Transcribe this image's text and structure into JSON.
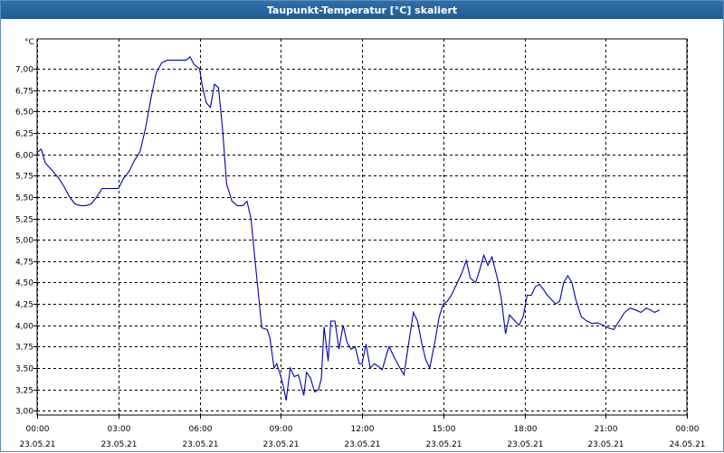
{
  "window": {
    "title": "Taupunkt-Temperatur [°C] skaliert"
  },
  "colors": {
    "titlebar": "#2a679e",
    "line": "#0000b0",
    "grid": "#000000"
  },
  "chart_data": {
    "type": "line",
    "title": "Taupunkt-Temperatur [°C] skaliert",
    "ylabel": "°C",
    "xlabel": "",
    "ylim": [
      3.0,
      7.25
    ],
    "xlim": [
      "23.05.21 00:00",
      "24.05.21 00:00"
    ],
    "grid": true,
    "y_ticks": [
      "3,00",
      "3,25",
      "3,50",
      "3,75",
      "4,00",
      "4,25",
      "4,50",
      "4,75",
      "5,00",
      "5,25",
      "5,50",
      "5,75",
      "6,00",
      "6,25",
      "6,50",
      "6,75",
      "7,00"
    ],
    "x_ticks": [
      {
        "time": "00:00",
        "date": "23.05.21"
      },
      {
        "time": "03:00",
        "date": "23.05.21"
      },
      {
        "time": "06:00",
        "date": "23.05.21"
      },
      {
        "time": "09:00",
        "date": "23.05.21"
      },
      {
        "time": "12:00",
        "date": "23.05.21"
      },
      {
        "time": "15:00",
        "date": "23.05.21"
      },
      {
        "time": "18:00",
        "date": "23.05.21"
      },
      {
        "time": "21:00",
        "date": "23.05.21"
      },
      {
        "time": "00:00",
        "date": "24.05.21"
      }
    ],
    "x_unit": "hours since 23.05.21 00:00",
    "series": [
      {
        "points": [
          [
            0.0,
            6.02
          ],
          [
            0.15,
            6.06
          ],
          [
            0.3,
            5.9
          ],
          [
            0.5,
            5.83
          ],
          [
            0.8,
            5.72
          ],
          [
            1.0,
            5.62
          ],
          [
            1.2,
            5.5
          ],
          [
            1.4,
            5.42
          ],
          [
            1.6,
            5.4
          ],
          [
            1.8,
            5.4
          ],
          [
            2.0,
            5.42
          ],
          [
            2.2,
            5.5
          ],
          [
            2.4,
            5.6
          ],
          [
            2.7,
            5.6
          ],
          [
            3.0,
            5.6
          ],
          [
            3.2,
            5.72
          ],
          [
            3.4,
            5.8
          ],
          [
            3.6,
            5.93
          ],
          [
            3.8,
            6.03
          ],
          [
            4.0,
            6.3
          ],
          [
            4.2,
            6.65
          ],
          [
            4.4,
            6.95
          ],
          [
            4.6,
            7.07
          ],
          [
            4.8,
            7.1
          ],
          [
            5.0,
            7.1
          ],
          [
            5.2,
            7.1
          ],
          [
            5.4,
            7.1
          ],
          [
            5.5,
            7.1
          ],
          [
            5.65,
            7.14
          ],
          [
            5.8,
            7.05
          ],
          [
            6.0,
            7.0
          ],
          [
            6.1,
            6.8
          ],
          [
            6.25,
            6.6
          ],
          [
            6.4,
            6.55
          ],
          [
            6.55,
            6.82
          ],
          [
            6.7,
            6.78
          ],
          [
            6.85,
            6.3
          ],
          [
            7.0,
            5.65
          ],
          [
            7.2,
            5.45
          ],
          [
            7.4,
            5.4
          ],
          [
            7.6,
            5.4
          ],
          [
            7.75,
            5.45
          ],
          [
            7.9,
            5.25
          ],
          [
            8.1,
            4.6
          ],
          [
            8.3,
            3.97
          ],
          [
            8.5,
            3.95
          ],
          [
            8.6,
            3.85
          ],
          [
            8.75,
            3.5
          ],
          [
            8.85,
            3.55
          ],
          [
            9.0,
            3.4
          ],
          [
            9.1,
            3.28
          ],
          [
            9.2,
            3.12
          ],
          [
            9.35,
            3.5
          ],
          [
            9.5,
            3.4
          ],
          [
            9.65,
            3.42
          ],
          [
            9.75,
            3.3
          ],
          [
            9.85,
            3.18
          ],
          [
            9.95,
            3.45
          ],
          [
            10.1,
            3.38
          ],
          [
            10.25,
            3.22
          ],
          [
            10.4,
            3.25
          ],
          [
            10.5,
            3.38
          ],
          [
            10.6,
            3.98
          ],
          [
            10.75,
            3.58
          ],
          [
            10.85,
            4.05
          ],
          [
            11.0,
            4.05
          ],
          [
            11.15,
            3.72
          ],
          [
            11.3,
            4.0
          ],
          [
            11.45,
            3.8
          ],
          [
            11.6,
            3.72
          ],
          [
            11.75,
            3.75
          ],
          [
            11.9,
            3.55
          ],
          [
            12.0,
            3.55
          ],
          [
            12.15,
            3.78
          ],
          [
            12.3,
            3.5
          ],
          [
            12.45,
            3.55
          ],
          [
            12.6,
            3.52
          ],
          [
            12.75,
            3.48
          ],
          [
            12.9,
            3.65
          ],
          [
            13.0,
            3.75
          ],
          [
            13.2,
            3.62
          ],
          [
            13.4,
            3.5
          ],
          [
            13.55,
            3.42
          ],
          [
            13.75,
            3.85
          ],
          [
            13.9,
            4.15
          ],
          [
            14.05,
            4.05
          ],
          [
            14.2,
            3.8
          ],
          [
            14.35,
            3.6
          ],
          [
            14.5,
            3.5
          ],
          [
            14.7,
            3.82
          ],
          [
            14.85,
            4.1
          ],
          [
            15.0,
            4.25
          ],
          [
            15.15,
            4.28
          ],
          [
            15.3,
            4.35
          ],
          [
            15.45,
            4.45
          ],
          [
            15.55,
            4.52
          ],
          [
            15.7,
            4.62
          ],
          [
            15.85,
            4.76
          ],
          [
            16.0,
            4.55
          ],
          [
            16.2,
            4.5
          ],
          [
            16.35,
            4.65
          ],
          [
            16.5,
            4.82
          ],
          [
            16.65,
            4.7
          ],
          [
            16.8,
            4.8
          ],
          [
            17.0,
            4.55
          ],
          [
            17.15,
            4.3
          ],
          [
            17.3,
            3.9
          ],
          [
            17.45,
            4.12
          ],
          [
            17.65,
            4.05
          ],
          [
            17.8,
            4.0
          ],
          [
            17.95,
            4.1
          ],
          [
            18.1,
            4.35
          ],
          [
            18.25,
            4.35
          ],
          [
            18.4,
            4.45
          ],
          [
            18.55,
            4.48
          ],
          [
            18.7,
            4.42
          ],
          [
            18.85,
            4.35
          ],
          [
            19.0,
            4.3
          ],
          [
            19.15,
            4.25
          ],
          [
            19.3,
            4.28
          ],
          [
            19.45,
            4.5
          ],
          [
            19.6,
            4.58
          ],
          [
            19.75,
            4.5
          ],
          [
            19.9,
            4.3
          ],
          [
            20.1,
            4.1
          ],
          [
            20.3,
            4.05
          ],
          [
            20.5,
            4.02
          ],
          [
            20.7,
            4.03
          ],
          [
            20.9,
            4.0
          ],
          [
            21.1,
            3.97
          ],
          [
            21.3,
            3.95
          ],
          [
            21.5,
            4.05
          ],
          [
            21.7,
            4.15
          ],
          [
            21.9,
            4.2
          ],
          [
            22.1,
            4.18
          ],
          [
            22.3,
            4.15
          ],
          [
            22.5,
            4.2
          ],
          [
            22.65,
            4.18
          ],
          [
            22.8,
            4.15
          ],
          [
            23.0,
            4.18
          ]
        ]
      }
    ]
  }
}
